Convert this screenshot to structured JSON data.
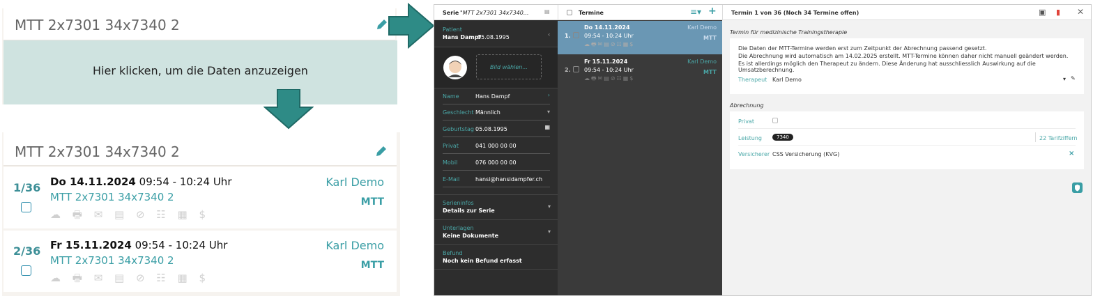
{
  "tutorial": {
    "series_title": "MTT 2x7301 34x7340 2",
    "click_hint": "Hier klicken, um die Daten anzuzeigen",
    "appointments": [
      {
        "num": "1/36",
        "day": "Do 14.11.2024",
        "time": "09:54 - 10:24 Uhr",
        "series": "MTT 2x7301 34x7340 2",
        "therapist": "Karl Demo",
        "type": "MTT",
        "icons": "☁ 🖶 ✉ ▤ ⊘ ☷ ▦ $"
      },
      {
        "num": "2/36",
        "day": "Fr 15.11.2024",
        "time": "09:54 - 10:24 Uhr",
        "series": "MTT 2x7301 34x7340 2",
        "therapist": "Karl Demo",
        "type": "MTT",
        "icons": "☁ 🖶 ✉ ▤ ⊘ ☷ ▦ $"
      }
    ]
  },
  "app": {
    "serie_label": "Serie",
    "serie_value": "\"MTT 2x7301 34x7340...",
    "patient_label": "Patient",
    "patient_name": "Hans Dampf",
    "patient_dob": "05.08.1995",
    "image_label": "Bild wählen...",
    "fields": [
      {
        "k": "Name",
        "v": "Hans Dampf"
      },
      {
        "k": "Geschlecht",
        "v": "Männlich"
      },
      {
        "k": "Geburtstag",
        "v": "05.08.1995"
      },
      {
        "k": "Privat",
        "v": "041 000 00 00"
      },
      {
        "k": "Mobil",
        "v": "076 000 00 00"
      },
      {
        "k": "E-Mail",
        "v": "hansi@hansidampfer.ch"
      }
    ],
    "sections": [
      {
        "k": "Serieninfos",
        "v": "Details zur Serie"
      },
      {
        "k": "Unterlagen",
        "v": "Keine Dokumente"
      },
      {
        "k": "Befund",
        "v": "Noch kein Befund erfasst"
      }
    ],
    "termine_label": "Termine",
    "termine": [
      {
        "n": "1.",
        "d": "Do 14.11.2024",
        "t": "09:54 - 10:24 Uhr",
        "w": "Karl Demo",
        "y": "MTT",
        "icons": "☁🖶✉▤⊘☷▦$"
      },
      {
        "n": "2.",
        "d": "Fr 15.11.2024",
        "t": "09:54 - 10:24 Uhr",
        "w": "Karl Demo",
        "y": "MTT",
        "icons": "☁🖶✉▤⊘☷▦$"
      }
    ],
    "detail_title": "Termin 1 von 36 (Noch 34 Termine offen)",
    "section1_title": "Termin für medizinische Trainingstherapie",
    "info_lines": [
      "Die Daten der MTT-Termine werden erst zum Zeitpunkt der Abrechnung passend gesetzt.",
      "Die Abrechnung wird automatisch am 14.02.2025 erstellt. MTT-Termine können daher nicht manuell geändert werden.",
      "Es ist allerdings möglich den Therapeut zu ändern. Diese Änderung hat ausschliesslich Auswirkung auf die Umsatzberechnung."
    ],
    "therapeut_label": "Therapeut",
    "therapeut_value": "Karl Demo",
    "section2_title": "Abrechnung",
    "privat_label": "Privat",
    "leistung_label": "Leistung",
    "leistung_value": "7340",
    "tarif_link": "22 Tarifziffern",
    "versicherer_label": "Versicherer",
    "versicherer_value": "CSS Versicherung (KVG)"
  }
}
